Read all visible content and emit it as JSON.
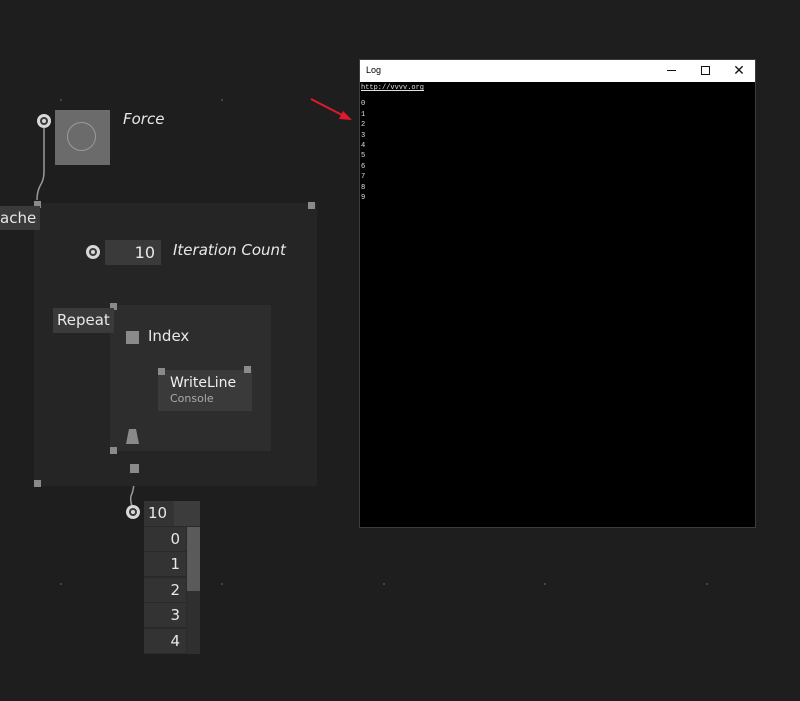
{
  "canvas": {
    "background": "#1e1e1e"
  },
  "force_node": {
    "label": "Force"
  },
  "foreach_region": {
    "label": "ache"
  },
  "iteration_input": {
    "value": "10",
    "label": "Iteration Count"
  },
  "repeat_region": {
    "label": "Repeat"
  },
  "index_node": {
    "label": "Index"
  },
  "writeline_node": {
    "title": "WriteLine",
    "subtitle": "Console"
  },
  "output_list": {
    "count": "10",
    "items": [
      "0",
      "1",
      "2",
      "3",
      "4"
    ],
    "scroll_fraction": 0.3
  },
  "log_window": {
    "title": "Log",
    "minimize_icon": "minimize-icon",
    "maximize_icon": "maximize-icon",
    "close_icon": "close-icon",
    "link_text": "http://vvvv.org",
    "lines": [
      "0",
      "1",
      "2",
      "3",
      "4",
      "5",
      "6",
      "7",
      "8",
      "9"
    ]
  },
  "annotation_arrow_color": "#e0192a"
}
